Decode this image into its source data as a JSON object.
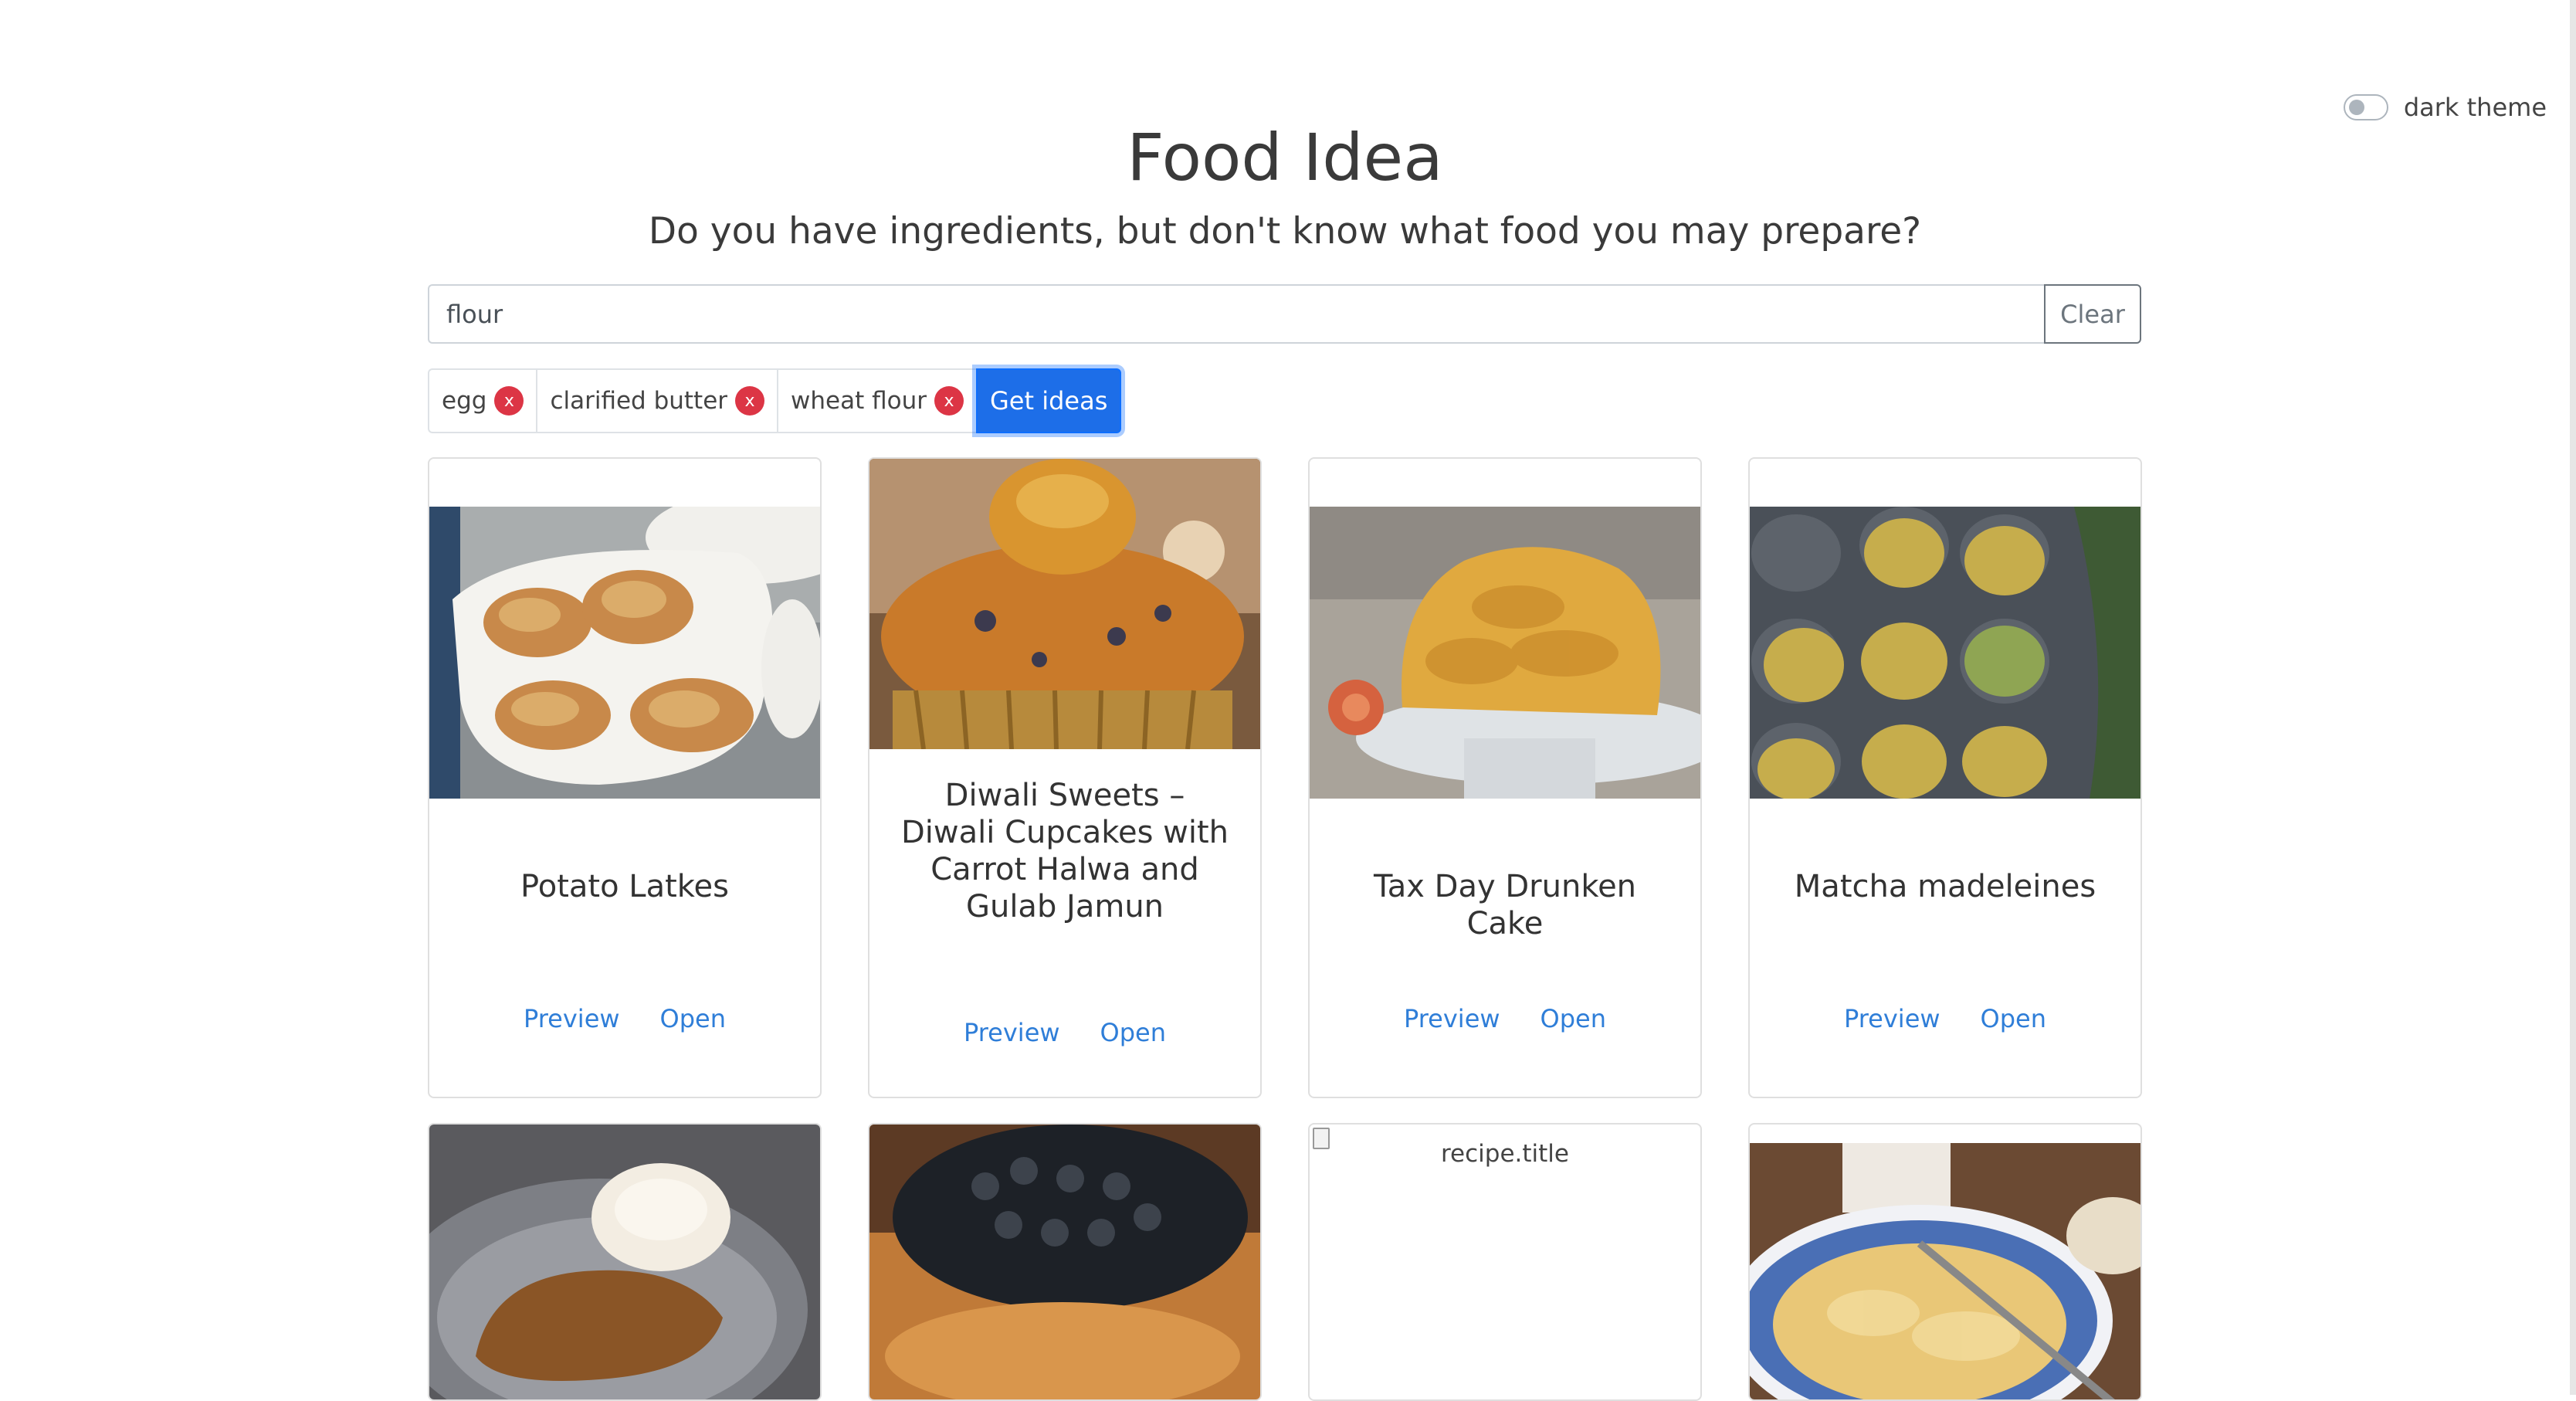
{
  "theme_toggle": {
    "label": "dark theme",
    "enabled": false
  },
  "header": {
    "title": "Food Idea",
    "subtitle": "Do you have ingredients, but don't know what food you may prepare?"
  },
  "search": {
    "value": "flour",
    "clear_label": "Clear"
  },
  "ingredients": [
    {
      "label": "egg",
      "remove": "x"
    },
    {
      "label": "clarified butter",
      "remove": "x"
    },
    {
      "label": "wheat flour",
      "remove": "x"
    }
  ],
  "get_ideas_label": "Get ideas",
  "recipes": [
    {
      "title": "Potato Latkes",
      "image": "potato-latkes-photo",
      "preview": "Preview",
      "open": "Open"
    },
    {
      "title": "Diwali Sweets – Diwali Cupcakes with Carrot Halwa and Gulab Jamun",
      "image": "diwali-cupcake-photo",
      "preview": "Preview",
      "open": "Open"
    },
    {
      "title": "Tax Day Drunken Cake",
      "image": "bundt-cake-photo",
      "preview": "Preview",
      "open": "Open"
    },
    {
      "title": "Matcha madeleines",
      "image": "matcha-madeleines-photo",
      "preview": "Preview",
      "open": "Open"
    },
    {
      "image": "schnitzel-mash-photo"
    },
    {
      "image": "caviar-blini-photo"
    },
    {
      "image_alt": "recipe.title"
    },
    {
      "image": "potato-omelette-photo"
    }
  ],
  "colors": {
    "link": "#2f7ed8",
    "primary": "#1d6ee8",
    "danger": "#dc3545"
  }
}
